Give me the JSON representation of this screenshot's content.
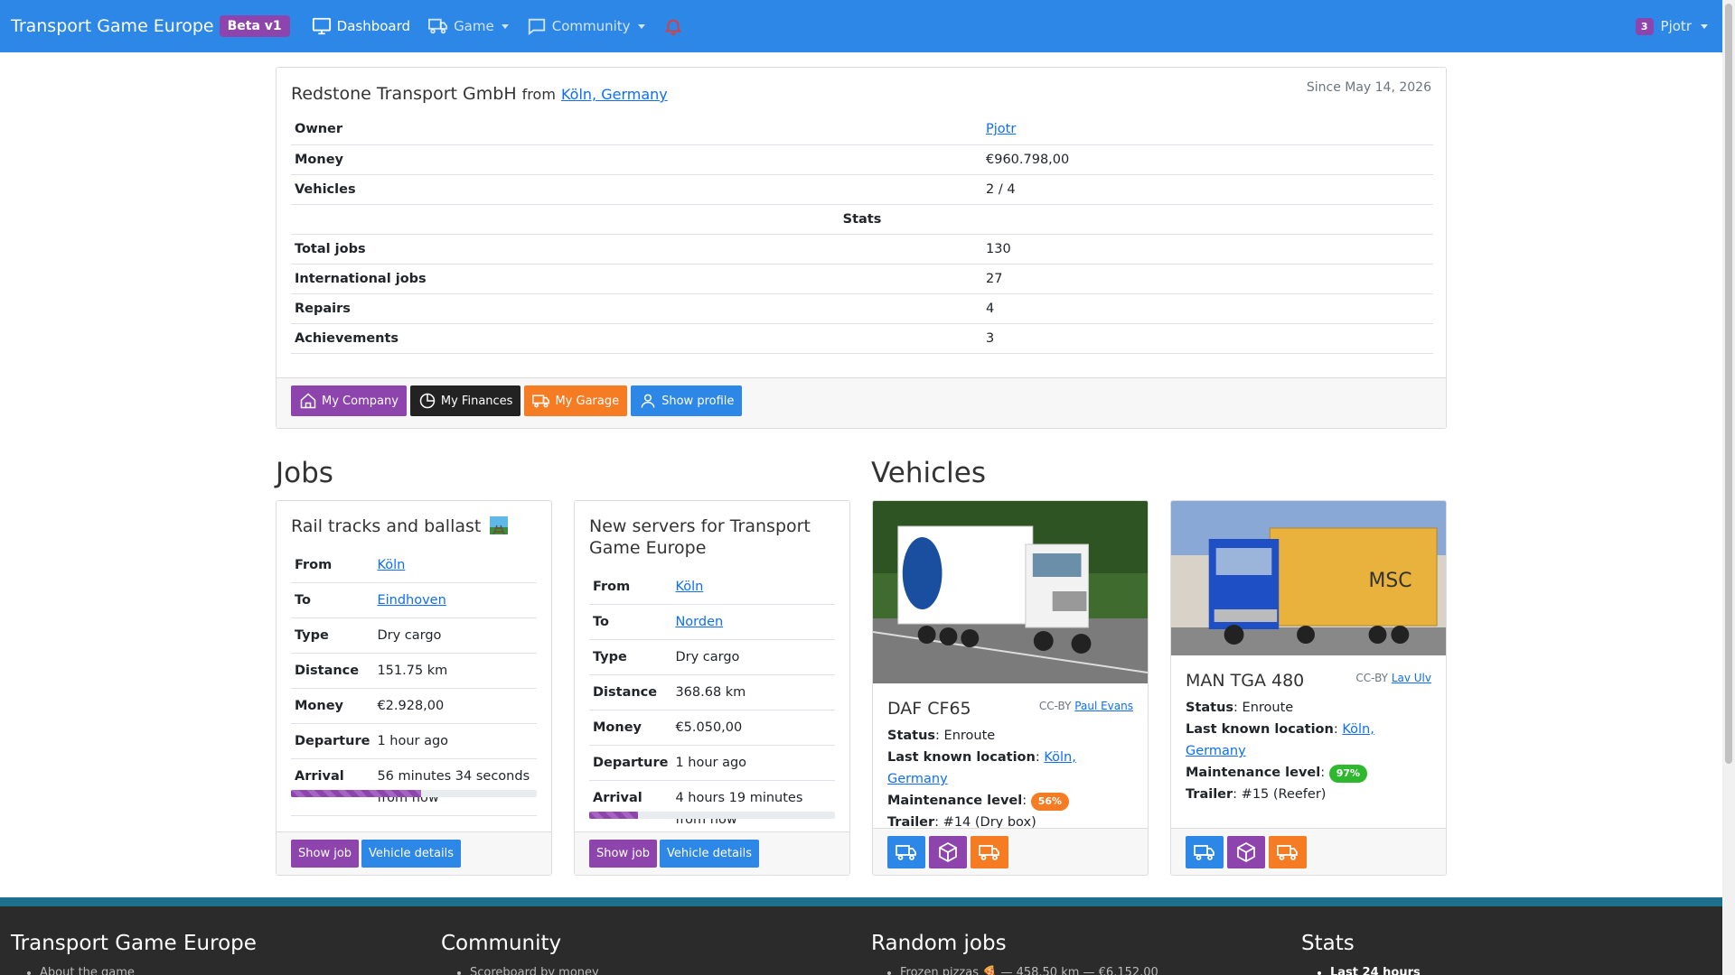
{
  "navbar": {
    "brand": "Transport Game Europe",
    "beta": "Beta v1",
    "dashboard": "Dashboard",
    "game": "Game",
    "community": "Community",
    "user_count": "3",
    "user_name": "Pjotr"
  },
  "company": {
    "name": "Redstone Transport GmbH",
    "from_label": "from",
    "location": "Köln, Germany",
    "since": "Since May 14, 2026",
    "owner_label": "Owner",
    "owner": "Pjotr",
    "money_label": "Money",
    "money": "€960.798,00",
    "vehicles_label": "Vehicles",
    "vehicles": "2 / 4",
    "stats_heading": "Stats",
    "total_jobs_label": "Total jobs",
    "total_jobs": "130",
    "intl_jobs_label": "International jobs",
    "intl_jobs": "27",
    "repairs_label": "Repairs",
    "repairs": "4",
    "achievements_label": "Achievements",
    "achievements": "3",
    "buttons": {
      "my_company": "My Company",
      "my_finances": "My Finances",
      "my_garage": "My Garage",
      "show_profile": "Show profile"
    }
  },
  "jobs_heading": "Jobs",
  "vehicles_heading": "Vehicles",
  "job_labels": {
    "from": "From",
    "to": "To",
    "type": "Type",
    "distance": "Distance",
    "money": "Money",
    "departure": "Departure",
    "arrival": "Arrival",
    "show_job": "Show job",
    "vehicle_details": "Vehicle details"
  },
  "jobs": [
    {
      "title": "Rail tracks and ballast",
      "from": "Köln",
      "to": "Eindhoven",
      "type": "Dry cargo",
      "distance": "151.75 km",
      "money": "€2.928,00",
      "departure": "1 hour ago",
      "arrival": "56 minutes 34 seconds from now",
      "progress": 0.53
    },
    {
      "title": "New servers for Transport Game Europe",
      "from": "Köln",
      "to": "Norden",
      "type": "Dry cargo",
      "distance": "368.68 km",
      "money": "€5.050,00",
      "departure": "1 hour ago",
      "arrival": "4 hours 19 minutes from now",
      "progress": 0.2
    }
  ],
  "vehicle_labels": {
    "cc_by": "CC-BY",
    "status": "Status",
    "last_location": "Last known location",
    "maintenance": "Maintenance level",
    "trailer": "Trailer"
  },
  "vehicles": [
    {
      "name": "DAF CF65",
      "credit": "Paul Evans",
      "status": "Enroute",
      "location": "Köln, Germany",
      "maintenance": "56%",
      "maintenance_color": "#f57c22",
      "trailer": "#14 (Dry box)"
    },
    {
      "name": "MAN TGA 480",
      "credit": "Lav Ulv",
      "status": "Enroute",
      "location": "Köln, Germany",
      "maintenance": "97%",
      "maintenance_color": "#2eb82e",
      "trailer": "#15 (Reefer)"
    }
  ],
  "footer": {
    "col1_title": "Transport Game Europe",
    "col1_item": "About the game",
    "col2_title": "Community",
    "col2_item": "Scoreboard by money",
    "col3_title": "Random jobs",
    "col3_item": "Frozen pizzas 🍕 — 458.50 km — €6.152,00",
    "col4_title": "Stats",
    "col4_item": "Last 24 hours"
  },
  "colors": {
    "primary": "#2d87e6",
    "purple": "#8e44ad",
    "orange": "#f57c22",
    "dark": "#222222"
  }
}
